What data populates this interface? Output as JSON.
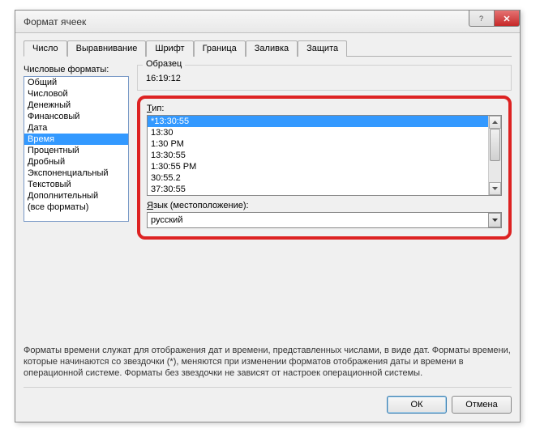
{
  "title": "Формат ячеек",
  "tabs": [
    "Число",
    "Выравнивание",
    "Шрифт",
    "Граница",
    "Заливка",
    "Защита"
  ],
  "activeTab": 0,
  "categoryLabel": "Числовые форматы:",
  "categories": [
    "Общий",
    "Числовой",
    "Денежный",
    "Финансовый",
    "Дата",
    "Время",
    "Процентный",
    "Дробный",
    "Экспоненциальный",
    "Текстовый",
    "Дополнительный",
    "(все форматы)"
  ],
  "selectedCategory": 5,
  "sampleLabel": "Образец",
  "sampleValue": "16:19:12",
  "typeLabel": "Тип:",
  "types": [
    "*13:30:55",
    "13:30",
    "1:30 PM",
    "13:30:55",
    "1:30:55 PM",
    "30:55.2",
    "37:30:55"
  ],
  "selectedType": 0,
  "langLabel": "Язык (местоположение):",
  "langValue": "русский",
  "description": "Форматы времени служат для отображения дат и времени, представленных числами, в виде дат. Форматы времени, которые начинаются со звездочки (*), меняются при изменении форматов отображения даты и времени в операционной системе. Форматы без звездочки не зависят от настроек операционной системы.",
  "okLabel": "ОК",
  "cancelLabel": "Отмена"
}
